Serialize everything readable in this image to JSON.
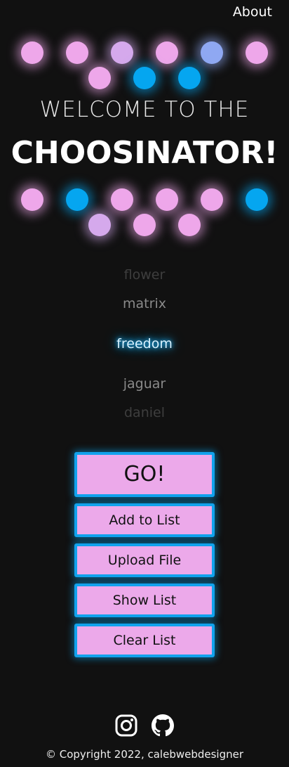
{
  "nav": {
    "about_label": "About"
  },
  "header": {
    "welcome": "WELCOME TO THE",
    "title": "CHOOSINATOR!"
  },
  "colors": {
    "background": "#111111",
    "pink": "#eea7ea",
    "lavender": "#d5a9ec",
    "blue": "#05a6f0",
    "periwinkle": "#8fa8f2",
    "button_fill": "#eca9ea",
    "button_border": "#11a2ec"
  },
  "dots_top": {
    "row1": [
      "pink",
      "pink",
      "lavender",
      "pink",
      "periwinkle",
      "pink"
    ],
    "row2": [
      "pink",
      "blue",
      "blue"
    ]
  },
  "dots_bottom": {
    "row1": [
      "pink",
      "blue",
      "pink",
      "pink",
      "pink",
      "blue"
    ],
    "row2": [
      "lavender",
      "pink",
      "pink"
    ]
  },
  "names": {
    "items": [
      "flower",
      "matrix",
      "freedom",
      "jaguar",
      "daniel"
    ],
    "selected": "freedom"
  },
  "buttons": {
    "go": "GO!",
    "add": "Add to List",
    "upload": "Upload File",
    "show": "Show List",
    "clear": "Clear List"
  },
  "footer": {
    "icons": [
      "instagram-icon",
      "github-icon"
    ],
    "copyright": "© Copyright 2022, calebwebdesigner"
  }
}
